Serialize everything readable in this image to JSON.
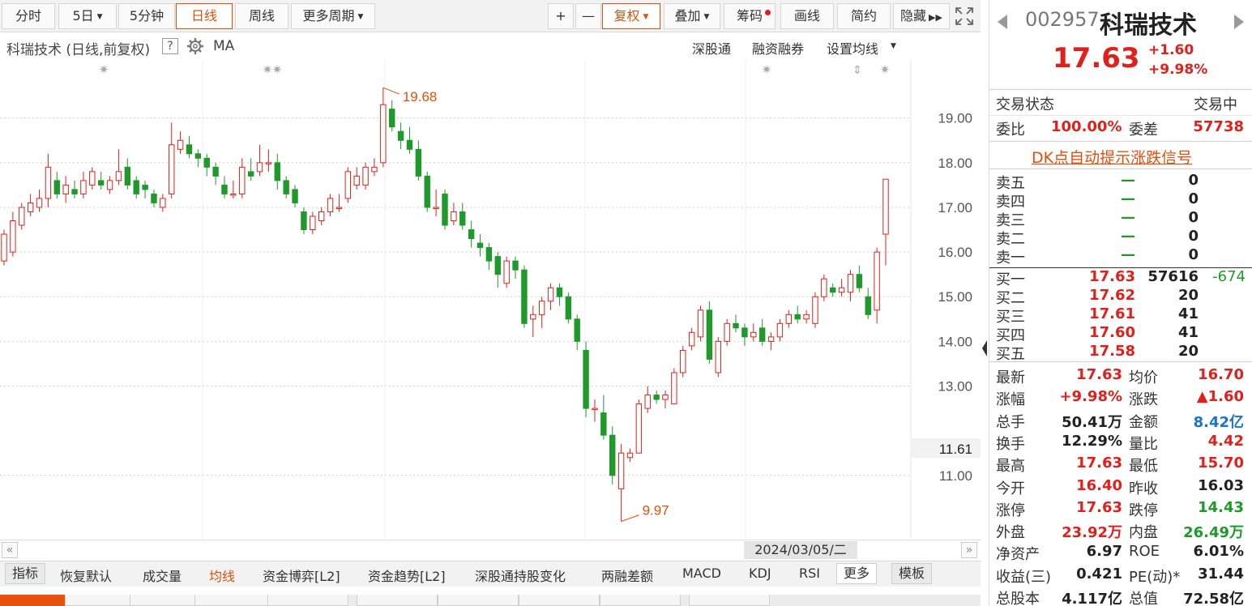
{
  "toolbar": {
    "tabs": [
      "分时",
      "5日",
      "5分钟",
      "日线",
      "周线",
      "更多周期"
    ],
    "plus": "+",
    "minus": "—",
    "fuquan": "复权",
    "diejia": "叠加",
    "chouma": "筹码",
    "huaxian": "画线",
    "jianyue": "简约",
    "yincang": "隐藏"
  },
  "header": {
    "title": "科瑞技术 (日线,前复权)",
    "help": "?",
    "ma": "MA",
    "links": [
      "深股通",
      "融资融券",
      "设置均线"
    ]
  },
  "stock": {
    "code": "002957",
    "name": "科瑞技术",
    "price": "17.63",
    "change": "+1.60",
    "change_pct": "+9.98%"
  },
  "panel": {
    "status_label": "交易状态",
    "status_value": "交易中",
    "weibi_label": "委比",
    "weibi_value": "100.00%",
    "weicha_label": "委差",
    "weicha_value": "57738",
    "dk_link": "DK点自动提示涨跌信号",
    "sell": [
      {
        "label": "卖五",
        "price": "—",
        "vol": "0"
      },
      {
        "label": "卖四",
        "price": "—",
        "vol": "0"
      },
      {
        "label": "卖三",
        "price": "—",
        "vol": "0"
      },
      {
        "label": "卖二",
        "price": "—",
        "vol": "0"
      },
      {
        "label": "卖一",
        "price": "—",
        "vol": "0"
      }
    ],
    "buy": [
      {
        "label": "买一",
        "price": "17.63",
        "vol": "57616",
        "delta": "-674"
      },
      {
        "label": "买二",
        "price": "17.62",
        "vol": "20",
        "delta": ""
      },
      {
        "label": "买三",
        "price": "17.61",
        "vol": "41",
        "delta": ""
      },
      {
        "label": "买四",
        "price": "17.60",
        "vol": "41",
        "delta": ""
      },
      {
        "label": "买五",
        "price": "17.58",
        "vol": "20",
        "delta": ""
      }
    ],
    "stats": [
      {
        "l1": "最新",
        "v1": "17.63",
        "c1": "red",
        "l2": "均价",
        "v2": "16.70",
        "c2": "red"
      },
      {
        "l1": "涨幅",
        "v1": "+9.98%",
        "c1": "red",
        "l2": "涨跌",
        "v2": "▲1.60",
        "c2": "red"
      },
      {
        "l1": "总手",
        "v1": "50.41万",
        "c1": "dark",
        "l2": "金额",
        "v2": "8.42亿",
        "c2": "blue"
      },
      {
        "l1": "换手",
        "v1": "12.29%",
        "c1": "dark",
        "l2": "量比",
        "v2": "4.42",
        "c2": "red"
      },
      {
        "l1": "最高",
        "v1": "17.63",
        "c1": "red",
        "l2": "最低",
        "v2": "15.70",
        "c2": "red"
      },
      {
        "l1": "今开",
        "v1": "16.40",
        "c1": "red",
        "l2": "昨收",
        "v2": "16.03",
        "c2": "dark"
      },
      {
        "l1": "涨停",
        "v1": "17.63",
        "c1": "red",
        "l2": "跌停",
        "v2": "14.43",
        "c2": "green"
      },
      {
        "l1": "外盘",
        "v1": "23.92万",
        "c1": "red",
        "l2": "内盘",
        "v2": "26.49万",
        "c2": "green"
      },
      {
        "l1": "净资产",
        "v1": "6.97",
        "c1": "dark",
        "l2": "ROE",
        "v2": "6.01%",
        "c2": "dark"
      },
      {
        "l1": "收益(三)",
        "v1": "0.421",
        "c1": "dark",
        "l2": "PE(动)*",
        "v2": "31.44",
        "c2": "dark"
      },
      {
        "l1": "总股本",
        "v1": "4.117亿",
        "c1": "dark",
        "l2": "总值",
        "v2": "72.58亿",
        "c2": "dark"
      }
    ]
  },
  "indicators": {
    "items": [
      "指标",
      "恢复默认",
      "成交量",
      "均线",
      "资金博弈[L2]",
      "资金趋势[L2]",
      "深股通持股变化",
      "两融差额",
      "MACD",
      "KDJ",
      "RSI",
      "更多",
      "模板"
    ]
  },
  "scroll": {
    "date": "2024/03/05/二"
  },
  "chart_data": {
    "type": "candlestick",
    "title": "科瑞技术 (日线,前复权)",
    "y_ticks": [
      "19.00",
      "18.00",
      "17.00",
      "16.00",
      "15.00",
      "14.00",
      "13.00",
      "11.00"
    ],
    "y_ticks_values": [
      19,
      18,
      17,
      16,
      15,
      14,
      13,
      11
    ],
    "ylim": [
      9.6,
      20.3
    ],
    "cursor_price": "11.61",
    "max_label": "19.68",
    "min_label": "9.97",
    "colors": {
      "up": "#e0201b",
      "down": "#1f9a2a"
    },
    "candles": [
      [
        15.8,
        16.4,
        16.5,
        15.7
      ],
      [
        16.0,
        16.7,
        16.9,
        15.9
      ],
      [
        16.6,
        17.0,
        17.1,
        16.5
      ],
      [
        16.9,
        17.1,
        17.3,
        16.8
      ],
      [
        17.0,
        17.2,
        17.4,
        16.9
      ],
      [
        17.2,
        17.9,
        18.2,
        17.0
      ],
      [
        17.6,
        17.3,
        17.8,
        17.2
      ],
      [
        17.3,
        17.5,
        17.7,
        17.1
      ],
      [
        17.4,
        17.3,
        17.6,
        17.2
      ],
      [
        17.3,
        17.6,
        17.8,
        17.2
      ],
      [
        17.5,
        17.8,
        17.9,
        17.4
      ],
      [
        17.6,
        17.5,
        17.8,
        17.4
      ],
      [
        17.4,
        17.6,
        17.7,
        17.3
      ],
      [
        17.6,
        17.8,
        18.3,
        17.5
      ],
      [
        17.9,
        17.5,
        18.1,
        17.4
      ],
      [
        17.6,
        17.3,
        17.7,
        17.2
      ],
      [
        17.5,
        17.4,
        17.6,
        17.2
      ],
      [
        17.3,
        17.1,
        17.4,
        17.0
      ],
      [
        17.0,
        17.2,
        17.3,
        16.9
      ],
      [
        17.3,
        18.4,
        18.9,
        17.2
      ],
      [
        18.3,
        18.5,
        18.7,
        18.2
      ],
      [
        18.4,
        18.2,
        18.6,
        18.1
      ],
      [
        18.2,
        18.1,
        18.3,
        17.9
      ],
      [
        18.1,
        17.9,
        18.2,
        17.7
      ],
      [
        17.9,
        17.7,
        18.0,
        17.5
      ],
      [
        17.5,
        17.3,
        17.7,
        17.2
      ],
      [
        17.3,
        17.3,
        17.6,
        17.2
      ],
      [
        17.3,
        17.9,
        18.1,
        17.2
      ],
      [
        17.8,
        17.7,
        18.1,
        17.6
      ],
      [
        17.8,
        18.0,
        18.4,
        17.7
      ],
      [
        18.0,
        18.0,
        18.3,
        17.8
      ],
      [
        18.0,
        17.6,
        18.2,
        17.4
      ],
      [
        17.6,
        17.3,
        17.7,
        17.2
      ],
      [
        17.4,
        17.1,
        17.5,
        17.0
      ],
      [
        16.9,
        16.5,
        17.0,
        16.4
      ],
      [
        16.5,
        16.8,
        16.9,
        16.4
      ],
      [
        16.7,
        16.9,
        17.0,
        16.6
      ],
      [
        16.9,
        17.2,
        17.3,
        16.8
      ],
      [
        17.0,
        17.0,
        17.3,
        16.9
      ],
      [
        17.2,
        17.8,
        17.9,
        17.1
      ],
      [
        17.5,
        17.7,
        17.9,
        17.4
      ],
      [
        17.5,
        17.9,
        18.0,
        17.4
      ],
      [
        17.8,
        17.9,
        18.1,
        17.7
      ],
      [
        18.0,
        19.3,
        19.68,
        17.9
      ],
      [
        19.2,
        18.8,
        19.4,
        18.7
      ],
      [
        18.7,
        18.5,
        18.9,
        18.3
      ],
      [
        18.5,
        18.3,
        18.8,
        18.2
      ],
      [
        18.3,
        17.7,
        18.5,
        17.6
      ],
      [
        17.7,
        17.0,
        17.8,
        16.9
      ],
      [
        17.0,
        17.0,
        17.4,
        16.8
      ],
      [
        17.3,
        16.6,
        17.4,
        16.5
      ],
      [
        16.7,
        16.9,
        17.1,
        16.6
      ],
      [
        16.9,
        16.6,
        17.1,
        16.5
      ],
      [
        16.5,
        16.3,
        16.7,
        16.1
      ],
      [
        16.2,
        16.1,
        16.4,
        15.9
      ],
      [
        16.1,
        15.8,
        16.2,
        15.6
      ],
      [
        15.9,
        15.5,
        16.0,
        15.2
      ],
      [
        15.3,
        15.8,
        15.9,
        15.2
      ],
      [
        15.8,
        15.6,
        15.9,
        15.4
      ],
      [
        15.6,
        14.4,
        15.7,
        14.3
      ],
      [
        14.5,
        14.6,
        14.8,
        14.1
      ],
      [
        14.6,
        14.9,
        15.0,
        14.3
      ],
      [
        14.9,
        15.2,
        15.3,
        14.7
      ],
      [
        15.2,
        15.0,
        15.3,
        14.8
      ],
      [
        15.0,
        14.5,
        15.1,
        14.4
      ],
      [
        14.5,
        14.0,
        14.6,
        13.8
      ],
      [
        13.8,
        12.5,
        14.0,
        12.3
      ],
      [
        12.5,
        12.5,
        12.7,
        12.2
      ],
      [
        12.4,
        11.9,
        12.8,
        11.8
      ],
      [
        11.9,
        11.0,
        12.1,
        10.8
      ],
      [
        10.7,
        11.5,
        11.7,
        9.97
      ],
      [
        11.4,
        11.5,
        11.6,
        11.3
      ],
      [
        11.5,
        12.6,
        12.7,
        11.5
      ],
      [
        12.5,
        12.8,
        13.0,
        12.4
      ],
      [
        12.8,
        12.7,
        12.9,
        12.6
      ],
      [
        12.7,
        12.8,
        12.9,
        12.5
      ],
      [
        12.6,
        13.3,
        13.4,
        12.6
      ],
      [
        13.3,
        13.8,
        13.9,
        13.2
      ],
      [
        13.9,
        14.2,
        14.3,
        13.8
      ],
      [
        14.1,
        14.7,
        14.8,
        14.0
      ],
      [
        14.7,
        13.6,
        14.9,
        13.5
      ],
      [
        13.3,
        14.0,
        14.1,
        13.2
      ],
      [
        14.0,
        14.4,
        14.5,
        13.9
      ],
      [
        14.4,
        14.3,
        14.6,
        14.2
      ],
      [
        14.3,
        14.1,
        14.4,
        13.9
      ],
      [
        14.1,
        14.2,
        14.4,
        14.0
      ],
      [
        14.3,
        14.0,
        14.5,
        13.9
      ],
      [
        14.0,
        14.1,
        14.2,
        13.8
      ],
      [
        14.1,
        14.4,
        14.5,
        14.0
      ],
      [
        14.4,
        14.6,
        14.7,
        14.3
      ],
      [
        14.6,
        14.5,
        14.8,
        14.4
      ],
      [
        14.5,
        14.6,
        14.7,
        14.4
      ],
      [
        14.4,
        15.0,
        15.1,
        14.3
      ],
      [
        15.0,
        15.4,
        15.5,
        14.9
      ],
      [
        15.2,
        15.1,
        15.3,
        15.0
      ],
      [
        15.1,
        15.2,
        15.4,
        15.0
      ],
      [
        15.1,
        15.5,
        15.6,
        14.9
      ],
      [
        15.5,
        15.2,
        15.7,
        15.1
      ],
      [
        15.0,
        14.6,
        15.2,
        14.5
      ],
      [
        14.7,
        16.0,
        16.1,
        14.4
      ],
      [
        16.4,
        17.63,
        17.63,
        15.7
      ]
    ]
  }
}
